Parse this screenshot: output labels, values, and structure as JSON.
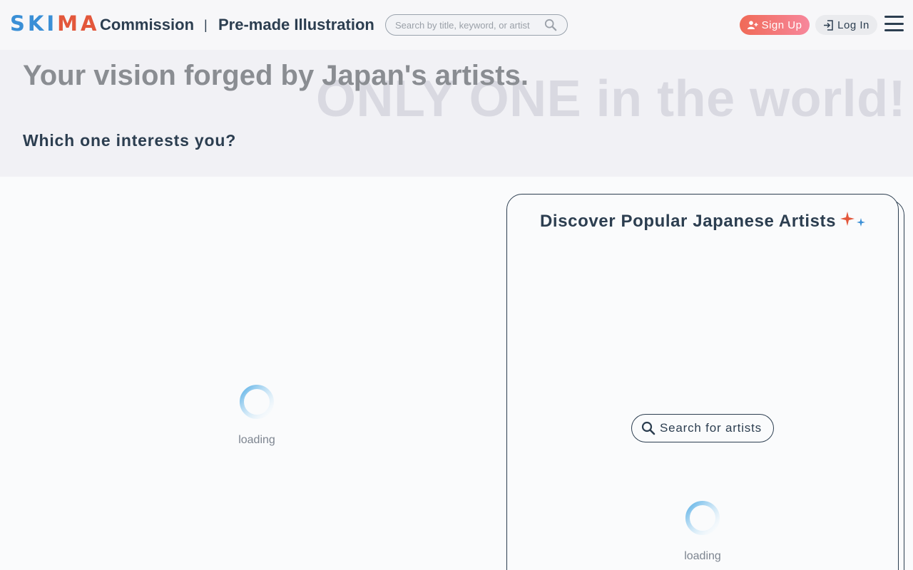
{
  "header": {
    "logo": {
      "letters": [
        "S",
        "K",
        "I",
        "M",
        "A"
      ]
    },
    "nav": {
      "commission": "Commission",
      "separator": "|",
      "premade": "Pre-made Illustration"
    },
    "search": {
      "placeholder": "Search by title, keyword, or artist",
      "value": ""
    },
    "signup_label": "Sign Up",
    "login_label": "Log In"
  },
  "hero": {
    "title": "Your vision forged by Japan's artists.",
    "background_text": "ONLY ONE in the world!",
    "subtitle": "Which one interests you?"
  },
  "left_panel": {
    "loading_text": "loading"
  },
  "artists_card": {
    "title": "Discover Popular Japanese Artists",
    "search_button_label": "Search for artists",
    "loading_text": "loading"
  },
  "colors": {
    "brand_blue": "#3a8fd6",
    "brand_red": "#e3573b",
    "text_dark": "#2c3e50",
    "signup_gradient_start": "#f06a57",
    "signup_gradient_end": "#f7879c",
    "hero_bg": "#f1f1f5"
  },
  "icons": {
    "search": "search-icon",
    "add_user": "add-user-icon",
    "login": "login-icon",
    "menu": "hamburger-menu-icon",
    "sparkle": "sparkle-icon",
    "spinner": "spinner-icon"
  }
}
